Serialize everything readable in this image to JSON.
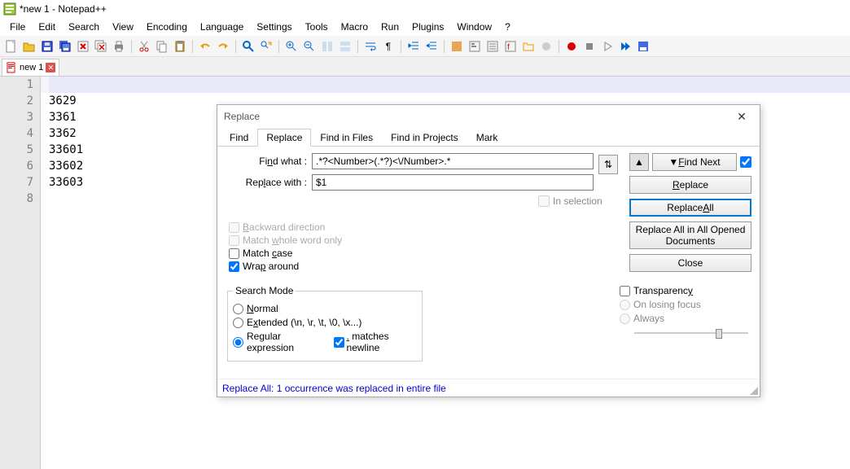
{
  "app": {
    "title": "*new 1 - Notepad++"
  },
  "menu": [
    "File",
    "Edit",
    "Search",
    "View",
    "Encoding",
    "Language",
    "Settings",
    "Tools",
    "Macro",
    "Run",
    "Plugins",
    "Window",
    "?"
  ],
  "tab": {
    "label": "new 1"
  },
  "editor": {
    "gutter": [
      "1",
      "2",
      "3",
      "4",
      "5",
      "6",
      "7",
      "8"
    ],
    "lines": [
      "",
      "3629",
      "3361",
      "3362",
      "33601",
      "33602",
      "33603",
      ""
    ]
  },
  "dialog": {
    "title": "Replace",
    "tabs": [
      "Find",
      "Replace",
      "Find in Files",
      "Find in Projects",
      "Mark"
    ],
    "active_tab": 1,
    "find_label_pre": "Fi",
    "find_label_u": "n",
    "find_label_post": "d what :",
    "replace_label_pre": "Rep",
    "replace_label_u": "l",
    "replace_label_post": "ace with :",
    "find_value": ".*?<Number>(.*?)<\\/Number>.*",
    "replace_value": "$1",
    "in_selection": "In selection",
    "swap": "⇅",
    "up": "▲",
    "findnext_pre": "▼ ",
    "findnext_u": "F",
    "findnext_post": "ind Next",
    "replace_btn_u": "R",
    "replace_btn_post": "eplace",
    "replaceall_pre": "Replace ",
    "replaceall_u": "A",
    "replaceall_post": "ll",
    "replace_opened": "Replace All in All Opened Documents",
    "close": "Close",
    "backward_u": "B",
    "backward_post": "ackward direction",
    "wholeword_pre": "Match ",
    "wholeword_u": "w",
    "wholeword_post": "hole word only",
    "matchcase_pre": "Match ",
    "matchcase_u": "c",
    "matchcase_post": "ase",
    "wrap_pre": "Wra",
    "wrap_u": "p",
    "wrap_post": " around",
    "search_mode": "Search Mode",
    "normal_u": "N",
    "normal_post": "ormal",
    "extended_pre": "E",
    "extended_u": "x",
    "extended_post": "tended (\\n, \\r, \\t, \\0, \\x...)",
    "regex_pre": "Re",
    "regex_u": "g",
    "regex_post": "ular expression",
    "matches_nl_u": ".",
    "matches_nl_post": " matches newline",
    "transparency_pre": "Transparenc",
    "transparency_u": "y",
    "on_losing": "On losing focus",
    "always": "Always",
    "status": "Replace All: 1 occurrence was replaced in entire file"
  }
}
